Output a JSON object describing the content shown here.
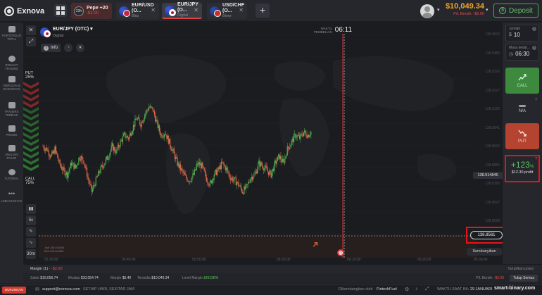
{
  "app": {
    "brand": "Exnova"
  },
  "tabs": [
    {
      "name": "Pepe +20",
      "sub": "-$2.00",
      "badge": "23h"
    },
    {
      "name": "EUR/USD (O...",
      "sub": "Blitz"
    },
    {
      "name": "EUR/JPY (O...",
      "sub": "Digital"
    },
    {
      "name": "USD/CHF (O...",
      "sub": "Biner"
    }
  ],
  "header": {
    "balance": "$10,049.34",
    "pl_label": "P/L Bersih: -$2.00",
    "deposit_label": "Deposit"
  },
  "sidebar": [
    {
      "label": "PORTOFOLIO TOTAL"
    },
    {
      "label": "RIWAYAT TRADING"
    },
    {
      "label": "OBROLAN & DUKUNGAN"
    },
    {
      "label": "TRADERS TERBAIK"
    },
    {
      "label": "PROMO"
    },
    {
      "label": "ANALISIS PASAR"
    },
    {
      "label": "TUTORIAL"
    },
    {
      "label": "LEBIH BANYAK"
    }
  ],
  "chart_header": {
    "asset": "EUR/JPY (OTC)",
    "type": "Digital",
    "info_label": "Info"
  },
  "sentiment": {
    "put_label": "PUT",
    "put_pct": "25%",
    "call_label": "CALL",
    "call_pct": "75%"
  },
  "timer": {
    "label_line1": "WAKTU",
    "label_line2": "PEMBELIAN",
    "value": "06:11"
  },
  "chart_tools": {
    "timeframe": "5s",
    "period": "30m"
  },
  "trade_info": {
    "line1": "Jual 138.914845",
    "line2": "Beli 138.914845"
  },
  "chart_data": {
    "type": "candlestick",
    "title": "",
    "xlabel": "",
    "ylabel": "",
    "x_ticks": [
      "05:30:00",
      "05:40:00",
      "05:50:00",
      "06:00:00",
      "06:10:00",
      "06:20:00",
      "06:30:00",
      "06:40:00",
      "07:00:00"
    ],
    "y_ticks": [
      "138.9600",
      "138.9480",
      "138.9320",
      "138.9227",
      "138.9125",
      "138.9041",
      "138.8962",
      "138.8880",
      "138.8780",
      "138.8697",
      "138.8598"
    ],
    "current_price": "138.914845",
    "strike_price": "138.8561",
    "close_path": [
      0.62,
      0.6,
      0.55,
      0.6,
      0.5,
      0.45,
      0.42,
      0.5,
      0.47,
      0.55,
      0.52,
      0.4,
      0.3,
      0.38,
      0.45,
      0.5,
      0.55,
      0.62,
      0.58,
      0.65,
      0.7,
      0.68,
      0.75,
      0.82,
      0.78,
      0.85,
      0.9,
      0.88,
      0.78,
      0.7,
      0.72,
      0.65,
      0.58,
      0.5,
      0.45,
      0.4,
      0.38,
      0.42,
      0.5,
      0.48,
      0.4,
      0.35,
      0.42,
      0.45,
      0.5,
      0.46,
      0.4,
      0.38,
      0.35,
      0.3,
      0.33,
      0.4,
      0.42,
      0.5,
      0.48,
      0.45,
      0.42,
      0.5,
      0.55,
      0.5,
      0.6,
      0.65,
      0.7,
      0.68,
      0.72,
      0.7,
      0.73
    ]
  },
  "right_panel": {
    "amount_label": "Jumlah",
    "amount_value": "10",
    "expiry_label": "Masa kedal...",
    "expiry_value": "06:30",
    "call_label": "CALL",
    "na_label": "N/A",
    "put_label": "PUT",
    "profit_pct": "+123",
    "profit_pct_unit": "%",
    "profit_amount": "$12.30 profit"
  },
  "chart_controls": {
    "hide_label": "Sembunyikan"
  },
  "bottom": {
    "margin_label": "Margin (1)",
    "margin_pl": "-$2.00",
    "positions_label": "Tampilkan posisi",
    "saldo": "$10,056.74",
    "ekuitas": "$10,054.74",
    "margin": "$5.40",
    "tersedia": "$10,049.34",
    "level_margin": "186198%",
    "pl_bersih_label": "P/L Bersih:",
    "pl_bersih_value": "-$2.00",
    "close_all": "Tutup Semua"
  },
  "footer": {
    "help": "DUKUNGAN",
    "email": "support@exnova.com",
    "hours": "SETIAP HARI, SEKITAR JAM",
    "developer": "Dikembangkan oleh",
    "developer_name": "FintechFuel",
    "time_label": "WAKTU SAAT INI:",
    "time_value": "29 JANUARI",
    "watermark": "smart-binary.com"
  }
}
